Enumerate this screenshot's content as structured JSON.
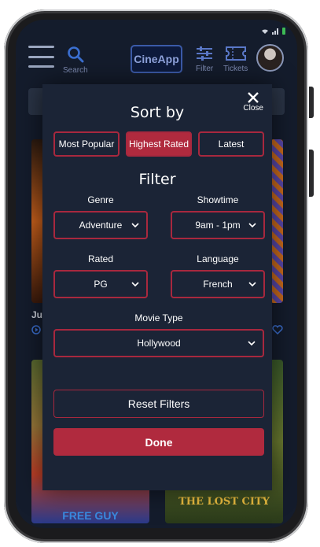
{
  "header": {
    "search_label": "Search",
    "logo_text": "CineApp",
    "filter_label": "Filter",
    "tickets_label": "Tickets"
  },
  "modal": {
    "sort_title": "Sort by",
    "close_label": "Close",
    "sort_options": [
      "Most Popular",
      "Highest Rated",
      "Latest"
    ],
    "active_sort": "Highest Rated",
    "filter_title": "Filter",
    "genre": {
      "label": "Genre",
      "value": "Adventure"
    },
    "showtime": {
      "label": "Showtime",
      "value": "9am - 1pm"
    },
    "rated": {
      "label": "Rated",
      "value": "PG"
    },
    "language": {
      "label": "Language",
      "value": "French"
    },
    "movie_type": {
      "label": "Movie Type",
      "value": "Hollywood"
    },
    "reset_label": "Reset Filters",
    "done_label": "Done"
  },
  "background": {
    "partial_title": "Ju",
    "poster_left_bottom_title": "FREE GUY",
    "poster_right_bottom_title": "THE LOST CITY"
  },
  "colors": {
    "screen_bg": "#141c2c",
    "modal_bg": "#1b2436",
    "accent": "#b02a3e",
    "header_icon": "#7e8bb2"
  }
}
